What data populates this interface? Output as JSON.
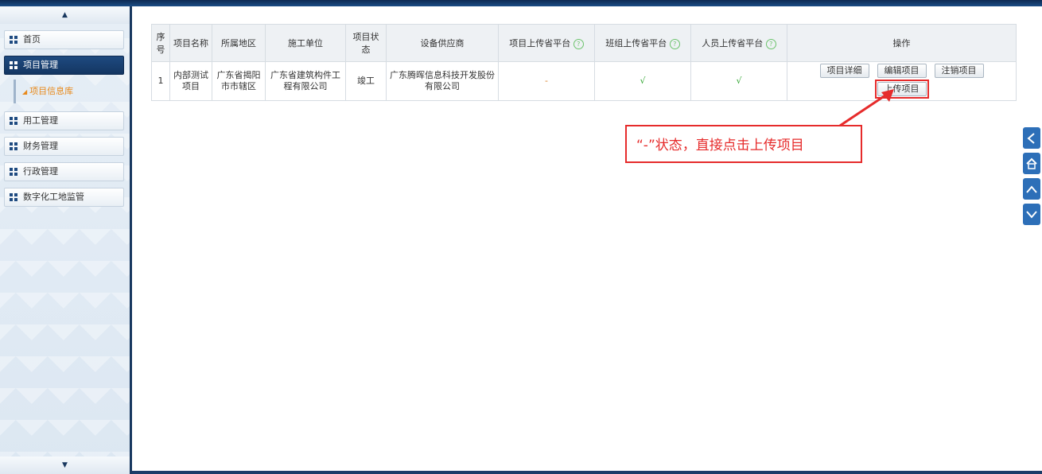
{
  "sidebar": {
    "items": [
      {
        "label": "首页",
        "active": false
      },
      {
        "label": "项目管理",
        "active": true
      },
      {
        "label": "用工管理",
        "active": false
      },
      {
        "label": "财务管理",
        "active": false
      },
      {
        "label": "行政管理",
        "active": false
      },
      {
        "label": "数字化工地监管",
        "active": false
      }
    ],
    "submenu_label": "项目信息库",
    "scroll_up_icon": "triangle-up-icon",
    "scroll_down_icon": "triangle-down-icon"
  },
  "table": {
    "headers": [
      "序号",
      "项目名称",
      "所属地区",
      "施工单位",
      "项目状态",
      "设备供应商",
      "项目上传省平台",
      "班组上传省平台",
      "人员上传省平台",
      "操作"
    ],
    "rows": [
      {
        "index": "1",
        "name": "内部测试项目",
        "region": "广东省揭阳市市辖区",
        "contractor": "广东省建筑构件工程有限公司",
        "status": "竣工",
        "supplier": "广东腾晖信息科技开发股份有限公司",
        "project_upload": "-",
        "team_upload": "√",
        "staff_upload": "√"
      }
    ],
    "buttons": {
      "detail": "项目详细",
      "edit": "编辑项目",
      "cancel": "注销项目",
      "upload": "上传项目"
    },
    "help_icon": "question-circle-icon"
  },
  "annotation": {
    "text": "“-”状态，直接点击上传项目",
    "color": "#e62b2b"
  },
  "right_nav": [
    "chevron-left-icon",
    "home-icon",
    "chevron-up-icon",
    "chevron-down-icon"
  ],
  "colors": {
    "accent": "#1e4a80",
    "submenu": "#e8891a",
    "check": "#2fa52f",
    "nav": "#2d6fb8"
  }
}
